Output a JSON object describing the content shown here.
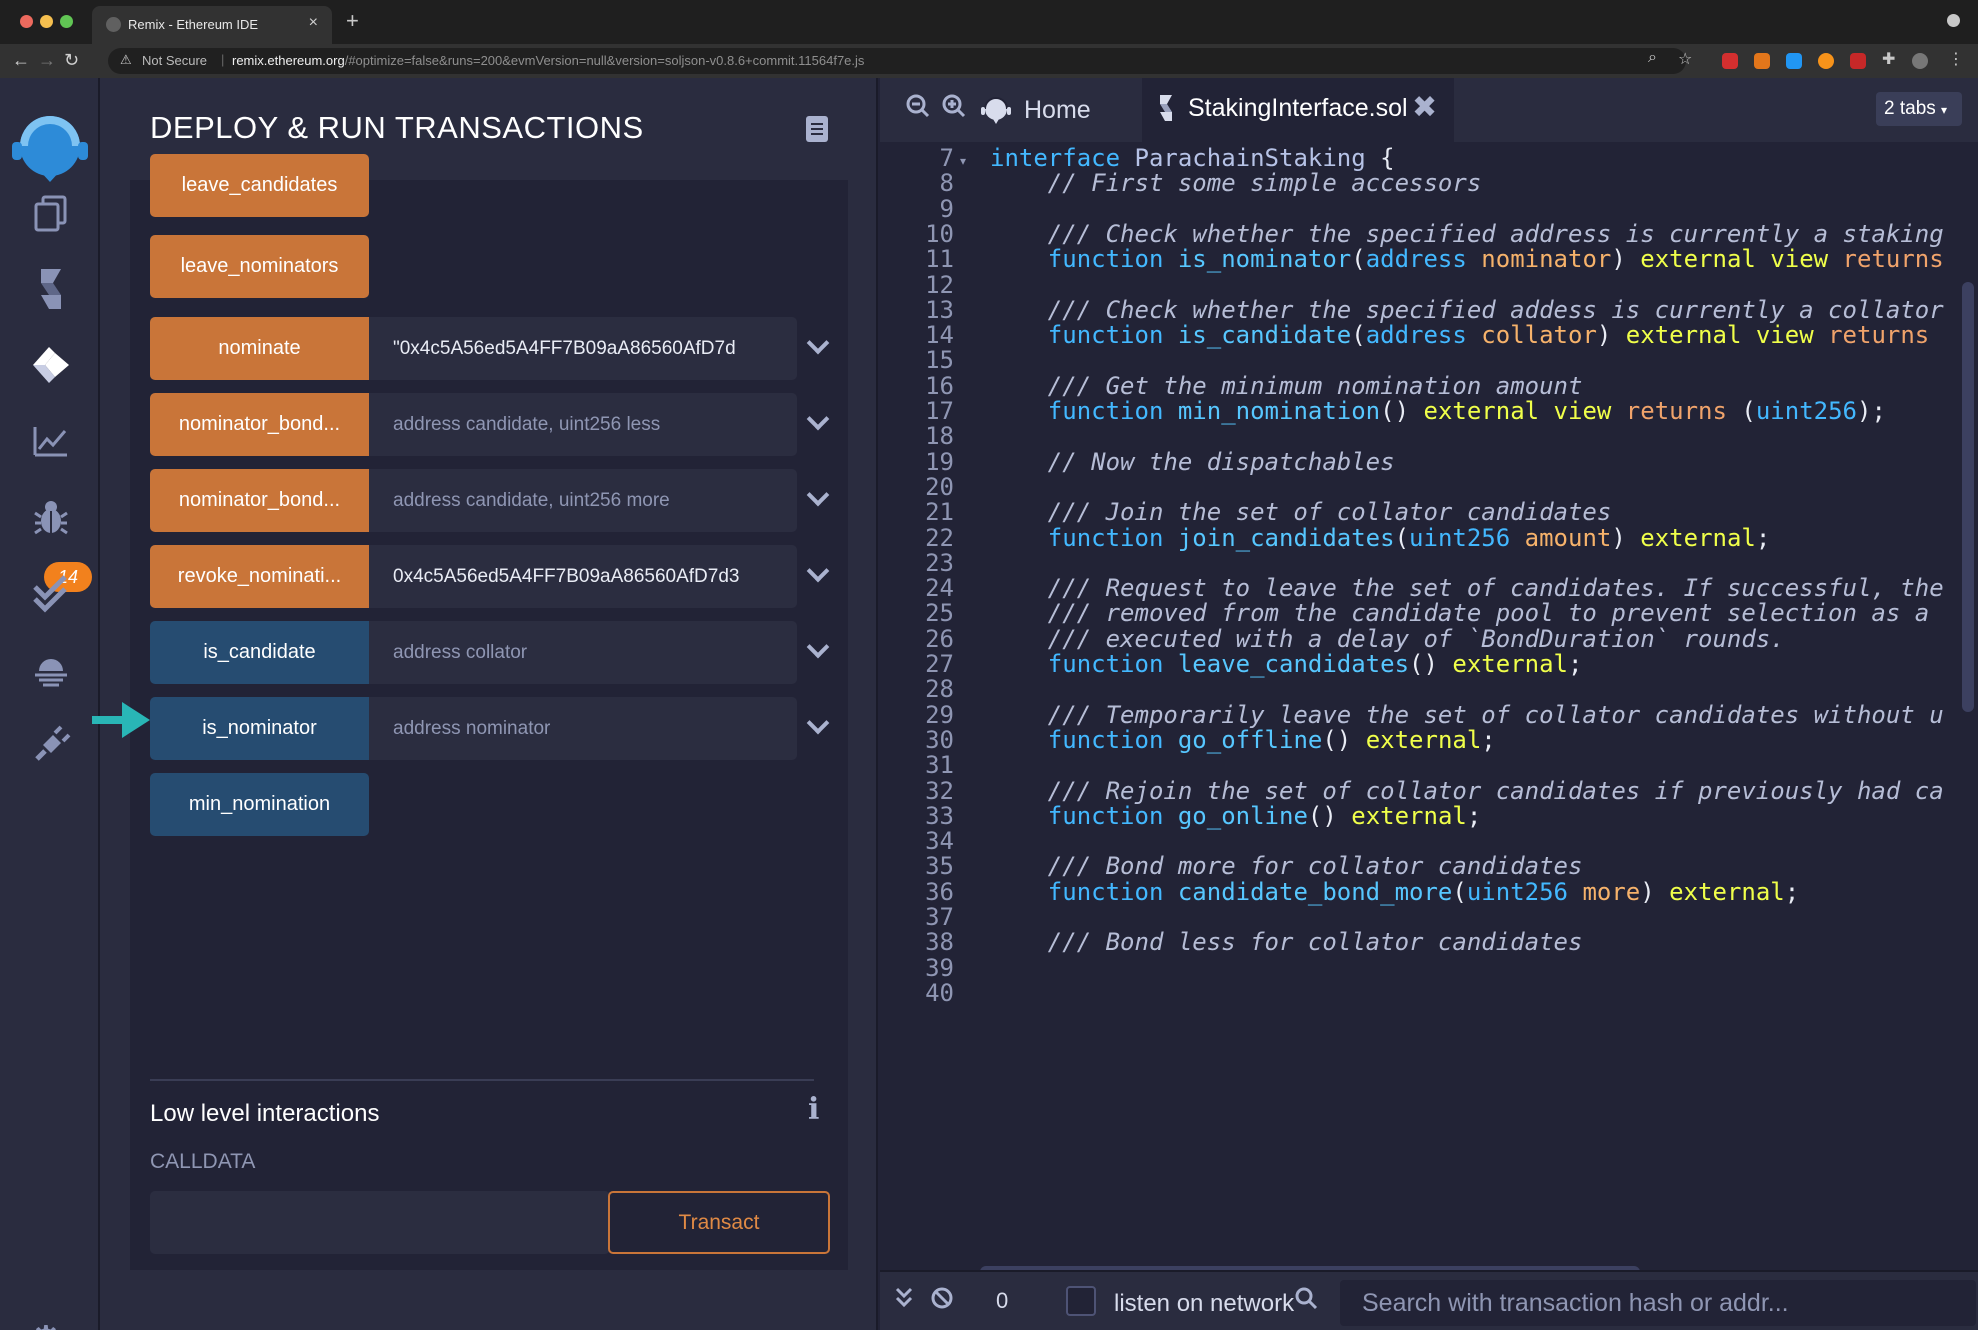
{
  "browser": {
    "tab_title": "Remix - Ethereum IDE",
    "close_tab": "×",
    "new_tab": "+",
    "security": "Not Secure",
    "url_host": "remix.ethereum.org",
    "url_path": "/#optimize=false&runs=200&evmVersion=null&version=soljson-v0.8.6+commit.11564f7e.js"
  },
  "sidebar": {
    "badge": "14",
    "icons": [
      "file-explorers-icon",
      "compile-icon",
      "deploy-run-icon",
      "analysis-icon",
      "debugger-icon",
      "test-icon",
      "plugin-manager-icon",
      "settings-icon"
    ]
  },
  "panel": {
    "title": "DEPLOY & RUN TRANSACTIONS",
    "functions": [
      {
        "label": "leave_candidates",
        "value": "",
        "placeholder": "",
        "kind": "orange"
      },
      {
        "label": "leave_nominators",
        "value": "",
        "placeholder": "",
        "kind": "orange"
      },
      {
        "label": "nominate",
        "value": "\"0x4c5A56ed5A4FF7B09aA86560AfD7d",
        "placeholder": "",
        "kind": "orange"
      },
      {
        "label": "nominator_bond...",
        "value": "",
        "placeholder": "address candidate, uint256 less",
        "kind": "orange"
      },
      {
        "label": "nominator_bond...",
        "value": "",
        "placeholder": "address candidate, uint256 more",
        "kind": "orange"
      },
      {
        "label": "revoke_nominati...",
        "value": "0x4c5A56ed5A4FF7B09aA86560AfD7d3",
        "placeholder": "",
        "kind": "orange"
      },
      {
        "label": "is_candidate",
        "value": "",
        "placeholder": "address collator",
        "kind": "blue"
      },
      {
        "label": "is_nominator",
        "value": "",
        "placeholder": "address nominator",
        "kind": "blue"
      },
      {
        "label": "min_nomination",
        "value": "",
        "placeholder": "",
        "kind": "blue"
      }
    ],
    "low_level_title": "Low level interactions",
    "calldata_label": "CALLDATA",
    "transact_label": "Transact"
  },
  "editor": {
    "home_tab": "Home",
    "file_tab": "StakingInterface.sol",
    "tabs_count": "2 tabs",
    "lines": [
      {
        "n": "7",
        "tokens": [
          [
            "kw",
            "interface"
          ],
          [
            "p",
            " "
          ],
          [
            "id",
            "ParachainStaking"
          ],
          [
            "p",
            " {"
          ]
        ]
      },
      {
        "n": "8",
        "tokens": [
          [
            "cm",
            "    // First some simple accessors"
          ]
        ]
      },
      {
        "n": "9",
        "tokens": []
      },
      {
        "n": "10",
        "tokens": [
          [
            "cm",
            "    /// Check whether the specified address is currently a staking"
          ]
        ]
      },
      {
        "n": "11",
        "tokens": [
          [
            "p",
            "    "
          ],
          [
            "kw",
            "function"
          ],
          [
            "p",
            " "
          ],
          [
            "fn",
            "is_nominator"
          ],
          [
            "p",
            "("
          ],
          [
            "kw",
            "address"
          ],
          [
            "p",
            " "
          ],
          [
            "var",
            "nominator"
          ],
          [
            "p",
            ") "
          ],
          [
            "mod",
            "external"
          ],
          [
            "p",
            " "
          ],
          [
            "mod",
            "view"
          ],
          [
            "p",
            " "
          ],
          [
            "ret",
            "returns"
          ]
        ]
      },
      {
        "n": "12",
        "tokens": []
      },
      {
        "n": "13",
        "tokens": [
          [
            "cm",
            "    /// Check whether the specified addess is currently a collator"
          ]
        ]
      },
      {
        "n": "14",
        "tokens": [
          [
            "p",
            "    "
          ],
          [
            "kw",
            "function"
          ],
          [
            "p",
            " "
          ],
          [
            "fn",
            "is_candidate"
          ],
          [
            "p",
            "("
          ],
          [
            "kw",
            "address"
          ],
          [
            "p",
            " "
          ],
          [
            "var",
            "collator"
          ],
          [
            "p",
            ") "
          ],
          [
            "mod",
            "external"
          ],
          [
            "p",
            " "
          ],
          [
            "mod",
            "view"
          ],
          [
            "p",
            " "
          ],
          [
            "ret",
            "returns"
          ]
        ]
      },
      {
        "n": "15",
        "tokens": []
      },
      {
        "n": "16",
        "tokens": [
          [
            "cm",
            "    /// Get the minimum nomination amount"
          ]
        ]
      },
      {
        "n": "17",
        "tokens": [
          [
            "p",
            "    "
          ],
          [
            "kw",
            "function"
          ],
          [
            "p",
            " "
          ],
          [
            "fn",
            "min_nomination"
          ],
          [
            "p",
            "() "
          ],
          [
            "mod",
            "external"
          ],
          [
            "p",
            " "
          ],
          [
            "mod",
            "view"
          ],
          [
            "p",
            " "
          ],
          [
            "ret",
            "returns"
          ],
          [
            "p",
            " ("
          ],
          [
            "kw",
            "uint256"
          ],
          [
            "p",
            ");"
          ]
        ]
      },
      {
        "n": "18",
        "tokens": []
      },
      {
        "n": "19",
        "tokens": [
          [
            "cm",
            "    // Now the dispatchables"
          ]
        ]
      },
      {
        "n": "20",
        "tokens": []
      },
      {
        "n": "21",
        "tokens": [
          [
            "cm",
            "    /// Join the set of collator candidates"
          ]
        ]
      },
      {
        "n": "22",
        "tokens": [
          [
            "p",
            "    "
          ],
          [
            "kw",
            "function"
          ],
          [
            "p",
            " "
          ],
          [
            "fn",
            "join_candidates"
          ],
          [
            "p",
            "("
          ],
          [
            "kw",
            "uint256"
          ],
          [
            "p",
            " "
          ],
          [
            "var",
            "amount"
          ],
          [
            "p",
            ") "
          ],
          [
            "mod",
            "external"
          ],
          [
            "p",
            ";"
          ]
        ]
      },
      {
        "n": "23",
        "tokens": []
      },
      {
        "n": "24",
        "tokens": [
          [
            "cm",
            "    /// Request to leave the set of candidates. If successful, the"
          ]
        ]
      },
      {
        "n": "25",
        "tokens": [
          [
            "cm",
            "    /// removed from the candidate pool to prevent selection as a"
          ]
        ]
      },
      {
        "n": "26",
        "tokens": [
          [
            "cm",
            "    /// executed with a delay of `BondDuration` rounds."
          ]
        ]
      },
      {
        "n": "27",
        "tokens": [
          [
            "p",
            "    "
          ],
          [
            "kw",
            "function"
          ],
          [
            "p",
            " "
          ],
          [
            "fn",
            "leave_candidates"
          ],
          [
            "p",
            "() "
          ],
          [
            "mod",
            "external"
          ],
          [
            "p",
            ";"
          ]
        ]
      },
      {
        "n": "28",
        "tokens": []
      },
      {
        "n": "29",
        "tokens": [
          [
            "cm",
            "    /// Temporarily leave the set of collator candidates without u"
          ]
        ]
      },
      {
        "n": "30",
        "tokens": [
          [
            "p",
            "    "
          ],
          [
            "kw",
            "function"
          ],
          [
            "p",
            " "
          ],
          [
            "fn",
            "go_offline"
          ],
          [
            "p",
            "() "
          ],
          [
            "mod",
            "external"
          ],
          [
            "p",
            ";"
          ]
        ]
      },
      {
        "n": "31",
        "tokens": []
      },
      {
        "n": "32",
        "tokens": [
          [
            "cm",
            "    /// Rejoin the set of collator candidates if previously had ca"
          ]
        ]
      },
      {
        "n": "33",
        "tokens": [
          [
            "p",
            "    "
          ],
          [
            "kw",
            "function"
          ],
          [
            "p",
            " "
          ],
          [
            "fn",
            "go_online"
          ],
          [
            "p",
            "() "
          ],
          [
            "mod",
            "external"
          ],
          [
            "p",
            ";"
          ]
        ]
      },
      {
        "n": "34",
        "tokens": []
      },
      {
        "n": "35",
        "tokens": [
          [
            "cm",
            "    /// Bond more for collator candidates"
          ]
        ]
      },
      {
        "n": "36",
        "tokens": [
          [
            "p",
            "    "
          ],
          [
            "kw",
            "function"
          ],
          [
            "p",
            " "
          ],
          [
            "fn",
            "candidate_bond_more"
          ],
          [
            "p",
            "("
          ],
          [
            "kw",
            "uint256"
          ],
          [
            "p",
            " "
          ],
          [
            "var",
            "more"
          ],
          [
            "p",
            ") "
          ],
          [
            "mod",
            "external"
          ],
          [
            "p",
            ";"
          ]
        ]
      },
      {
        "n": "37",
        "tokens": []
      },
      {
        "n": "38",
        "tokens": [
          [
            "cm",
            "    /// Bond less for collator candidates"
          ]
        ]
      },
      {
        "n": "39",
        "tokens": []
      },
      {
        "n": "40",
        "tokens": []
      }
    ]
  },
  "terminal": {
    "count": "0",
    "listen_label": "listen on network",
    "search_placeholder": "Search with transaction hash or addr..."
  },
  "colors": {
    "orange_button": "#c97539",
    "blue_button": "#264c71",
    "arrow": "#29b6b6",
    "badge": "#f2811d"
  }
}
